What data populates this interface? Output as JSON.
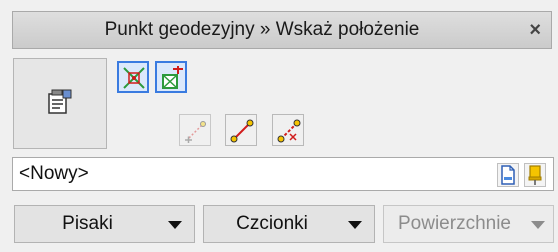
{
  "title_bar": {
    "title": "Punkt geodezyjny » Wskaż położenie",
    "close_glyph": "×"
  },
  "toolbar": {
    "properties_button_icon": "properties-icon",
    "row1": [
      {
        "name": "snap-intersection-button",
        "icon": "snap-intersection-icon",
        "active": true
      },
      {
        "name": "snap-insert-point-button",
        "icon": "snap-insert-point-icon",
        "active": true
      }
    ],
    "row2": [
      {
        "name": "snap-offset-point-button",
        "icon": "snap-offset-point-icon",
        "enabled": false
      },
      {
        "name": "snap-line-endpoints-button",
        "icon": "snap-line-endpoints-icon",
        "enabled": true
      },
      {
        "name": "snap-line-cut-button",
        "icon": "snap-line-cut-icon",
        "enabled": true
      }
    ]
  },
  "name_field": {
    "value": "<Nowy>",
    "new_icon": "new-document-icon",
    "pin_icon": "pin-icon"
  },
  "dropdowns": {
    "pens": {
      "label": "Pisaki",
      "enabled": true
    },
    "fonts": {
      "label": "Czcionki",
      "enabled": true
    },
    "surfaces": {
      "label": "Powierzchnie",
      "enabled": false
    }
  },
  "colors": {
    "active_border": "#3a7be0",
    "icon_green": "#2c9a3c",
    "icon_red": "#d11c1c",
    "icon_yellow": "#f5c400"
  }
}
